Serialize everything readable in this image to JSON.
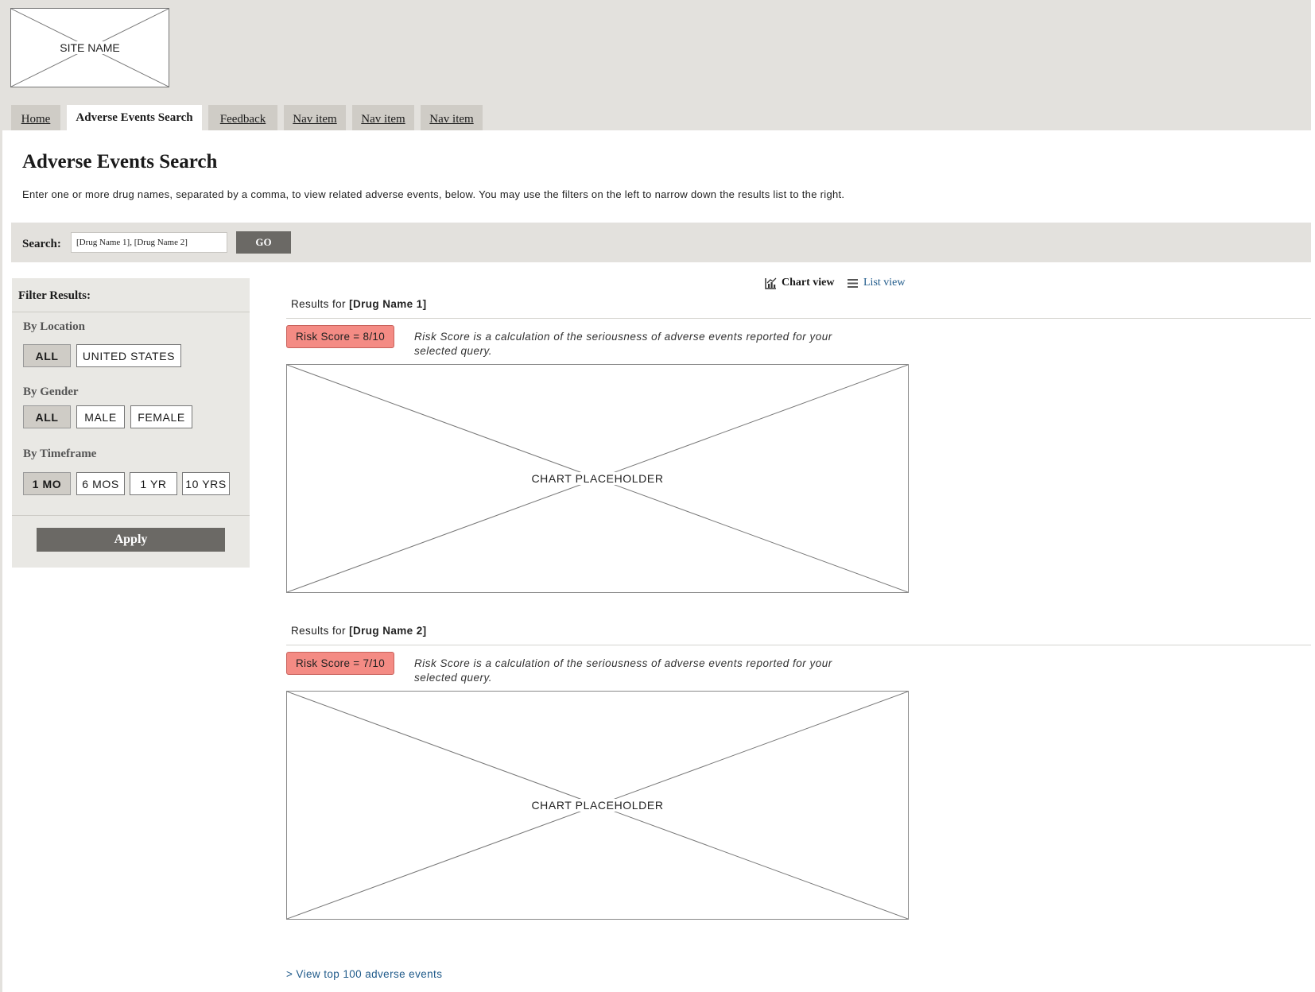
{
  "header": {
    "logo_text": "SITE NAME"
  },
  "nav": {
    "tabs": [
      {
        "label": "Home"
      },
      {
        "label": "Adverse Events Search"
      },
      {
        "label": "Feedback"
      },
      {
        "label": "Nav item"
      },
      {
        "label": "Nav item"
      },
      {
        "label": "Nav item"
      }
    ],
    "active_tab": "Adverse Events Search"
  },
  "main": {
    "title": "Adverse Events Search",
    "intro": "Enter one or more drug names, separated by a comma, to view related adverse events, below.  You may use the filters on the left to narrow down the results list to the right."
  },
  "search": {
    "label": "Search:",
    "value": "[Drug Name 1], [Drug Name 2]",
    "go_label": "GO"
  },
  "filters": {
    "title": "Filter Results:",
    "location": {
      "label": "By Location",
      "options": [
        "ALL",
        "UNITED STATES"
      ],
      "selected": "ALL"
    },
    "gender": {
      "label": "By Gender",
      "options": [
        "ALL",
        "MALE",
        "FEMALE"
      ],
      "selected": "ALL"
    },
    "timeframe": {
      "label": "By Timeframe",
      "options": [
        "1 MO",
        "6 MOS",
        "1 YR",
        "10 YRS"
      ],
      "selected": "1 MO"
    },
    "apply_label": "Apply"
  },
  "view_toggle": {
    "chart_label": "Chart view",
    "list_label": "List view",
    "active": "Chart view"
  },
  "results": [
    {
      "prefix": "Results for ",
      "drug": "[Drug Name 1]",
      "risk_score": "Risk Score = 8/10",
      "risk_note": "Risk Score is a calculation of the seriousness of adverse events reported for your selected query.",
      "chart_placeholder": "CHART PLACEHOLDER"
    },
    {
      "prefix": "Results for ",
      "drug": "[Drug Name 2]",
      "risk_score": "Risk Score = 7/10",
      "risk_note": "Risk Score is a calculation of the seriousness of adverse events reported for your selected query.",
      "chart_placeholder": "CHART PLACEHOLDER"
    }
  ],
  "footer_link": ">  View top 100 adverse events",
  "colors": {
    "header_bg": "#e3e1dd",
    "risk_badge": "#f48b84",
    "button_dark": "#6b6965",
    "link": "#1f5a8a"
  }
}
